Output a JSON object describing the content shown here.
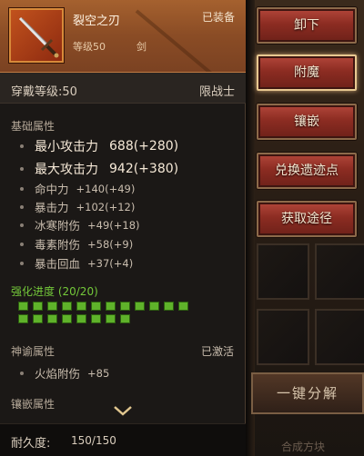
{
  "item": {
    "name": "裂空之刃",
    "level_label": "等级50",
    "type": "剑",
    "status": "已装备",
    "icon": "sword-icon"
  },
  "requirement": {
    "label": "穿戴等级:50",
    "class": "限战士"
  },
  "base_attributes": {
    "title": "基础属性",
    "stats": [
      {
        "name": "最小攻击力",
        "value": "688(+280)"
      },
      {
        "name": "最大攻击力",
        "value": "942(+380)"
      },
      {
        "name": "命中力",
        "value": "+140(+49)"
      },
      {
        "name": "暴击力",
        "value": "+102(+12)"
      },
      {
        "name": "冰寒附伤",
        "value": "+49(+18)"
      },
      {
        "name": "毒素附伤",
        "value": "+58(+9)"
      },
      {
        "name": "暴击回血",
        "value": "+37(+4)"
      }
    ]
  },
  "enhancement": {
    "title": "强化进度 (20/20)",
    "current": 20,
    "max": 20,
    "pip_color": "#5fb22a"
  },
  "oracle": {
    "title": "神谕属性",
    "status": "已激活",
    "stats": [
      {
        "name": "火焰附伤",
        "value": "+85"
      }
    ]
  },
  "inlay": {
    "title": "镶嵌属性"
  },
  "durability": {
    "label": "耐久度:",
    "value": "150/150"
  },
  "actions": {
    "unequip": "卸下",
    "enchant": "附魔",
    "inlay": "镶嵌",
    "exchange": "兑换遗迹点",
    "obtain": "获取途径",
    "decompose": "一键分解",
    "synthesize": "合成方块"
  },
  "colors": {
    "header": "#8a4c25",
    "button": "#8c2c22",
    "enhance_text": "#74c93a"
  }
}
